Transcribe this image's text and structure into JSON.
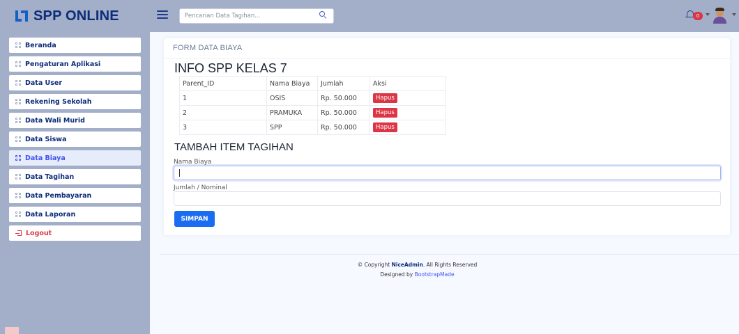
{
  "header": {
    "app_title": "SPP ONLINE",
    "search_placeholder": "Pencarian Data Tagihan...",
    "notification_count": "0"
  },
  "sidebar": {
    "items": [
      {
        "label": "Beranda",
        "icon": "grid-icon"
      },
      {
        "label": "Pengaturan Aplikasi",
        "icon": "grid-icon"
      },
      {
        "label": "Data User",
        "icon": "grid-icon"
      },
      {
        "label": "Rekening Sekolah",
        "icon": "grid-icon"
      },
      {
        "label": "Data Wali Murid",
        "icon": "grid-icon"
      },
      {
        "label": "Data Siswa",
        "icon": "grid-icon"
      },
      {
        "label": "Data Biaya",
        "icon": "grid-icon",
        "active": true
      },
      {
        "label": "Data Tagihan",
        "icon": "grid-icon"
      },
      {
        "label": "Data Pembayaran",
        "icon": "grid-icon"
      },
      {
        "label": "Data Laporan",
        "icon": "grid-icon"
      },
      {
        "label": "Logout",
        "icon": "logout-icon"
      }
    ]
  },
  "main": {
    "card_title": "FORM DATA BIAYA",
    "info_heading": "INFO SPP KELAS 7",
    "table": {
      "headers": [
        "Parent_ID",
        "Nama Biaya",
        "Jumlah",
        "Aksi"
      ],
      "rows": [
        {
          "id": "1",
          "nama": "OSIS",
          "jumlah": "Rp. 50.000",
          "aksi": "Hapus"
        },
        {
          "id": "2",
          "nama": "PRAMUKA",
          "jumlah": "Rp. 50.000",
          "aksi": "Hapus"
        },
        {
          "id": "3",
          "nama": "SPP",
          "jumlah": "Rp. 50.000",
          "aksi": "Hapus"
        }
      ]
    },
    "form": {
      "heading": "TAMBAH ITEM TAGIHAN",
      "field1_label": "Nama Biaya",
      "field1_value": "",
      "field2_label": "Jumlah / Nominal",
      "field2_value": "",
      "submit_label": "SIMPAN"
    }
  },
  "footer": {
    "copyright_prefix": "© Copyright ",
    "brand": "NiceAdmin",
    "copyright_suffix": ". All Rights Reserved",
    "designed_prefix": "Designed by ",
    "designed_link": "BootstrapMade"
  },
  "colors": {
    "header_bg": "#a3aec8",
    "brand": "#0d2d7a",
    "primary_button": "#1a6df0",
    "danger": "#dc3545"
  }
}
